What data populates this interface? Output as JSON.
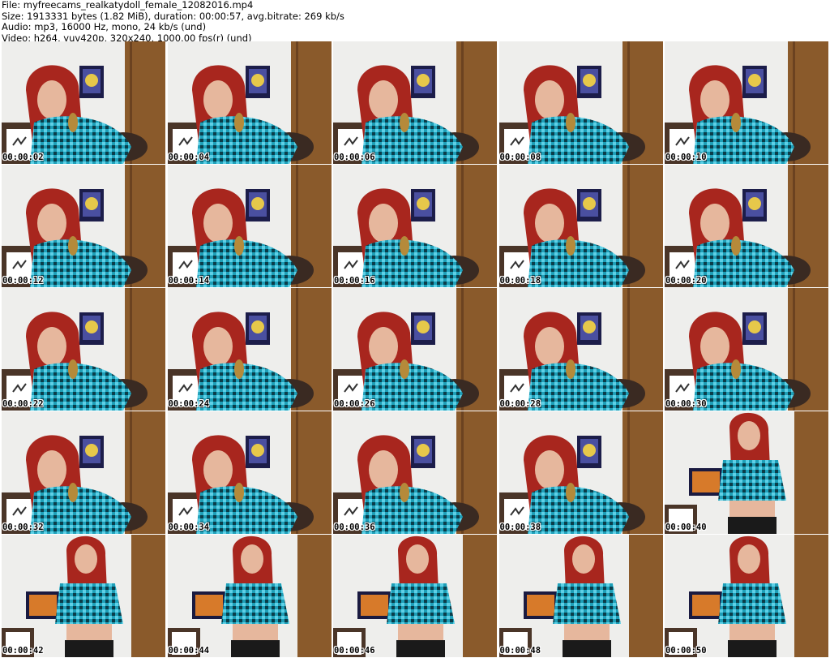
{
  "header": {
    "file": "File: myfreecams_realkatydoll_female_12082016.mp4",
    "size": "Size: 1913331 bytes (1.82 MiB), duration: 00:00:57, avg.bitrate: 269 kb/s",
    "audio": "Audio: mp3, 16000 Hz, mono, 24 kb/s (und)",
    "video": "Video: h264, yuv420p, 320x240, 1000.00 fps(r) (und)"
  },
  "thumbnails": [
    {
      "timestamp": "00:00:02",
      "scene": "lean"
    },
    {
      "timestamp": "00:00:04",
      "scene": "lean"
    },
    {
      "timestamp": "00:00:06",
      "scene": "lean"
    },
    {
      "timestamp": "00:00:08",
      "scene": "lean"
    },
    {
      "timestamp": "00:00:10",
      "scene": "lean"
    },
    {
      "timestamp": "00:00:12",
      "scene": "lean"
    },
    {
      "timestamp": "00:00:14",
      "scene": "lean"
    },
    {
      "timestamp": "00:00:16",
      "scene": "lean"
    },
    {
      "timestamp": "00:00:18",
      "scene": "lean"
    },
    {
      "timestamp": "00:00:20",
      "scene": "lean"
    },
    {
      "timestamp": "00:00:22",
      "scene": "lean"
    },
    {
      "timestamp": "00:00:24",
      "scene": "lean"
    },
    {
      "timestamp": "00:00:26",
      "scene": "lean"
    },
    {
      "timestamp": "00:00:28",
      "scene": "lean"
    },
    {
      "timestamp": "00:00:30",
      "scene": "lean"
    },
    {
      "timestamp": "00:00:32",
      "scene": "lean"
    },
    {
      "timestamp": "00:00:34",
      "scene": "lean"
    },
    {
      "timestamp": "00:00:36",
      "scene": "lean"
    },
    {
      "timestamp": "00:00:38",
      "scene": "lean"
    },
    {
      "timestamp": "00:00:40",
      "scene": "stand"
    },
    {
      "timestamp": "00:00:42",
      "scene": "stand"
    },
    {
      "timestamp": "00:00:44",
      "scene": "stand"
    },
    {
      "timestamp": "00:00:46",
      "scene": "stand"
    },
    {
      "timestamp": "00:00:48",
      "scene": "stand"
    },
    {
      "timestamp": "00:00:50",
      "scene": "stand"
    }
  ],
  "colors": {
    "wall": "#eeeeec",
    "door": "#8a5a2b",
    "hair": "#a8261e",
    "shirt": "#1e9fb8",
    "shirt_dark": "#0b3d4a",
    "skin": "#e6b79d"
  }
}
